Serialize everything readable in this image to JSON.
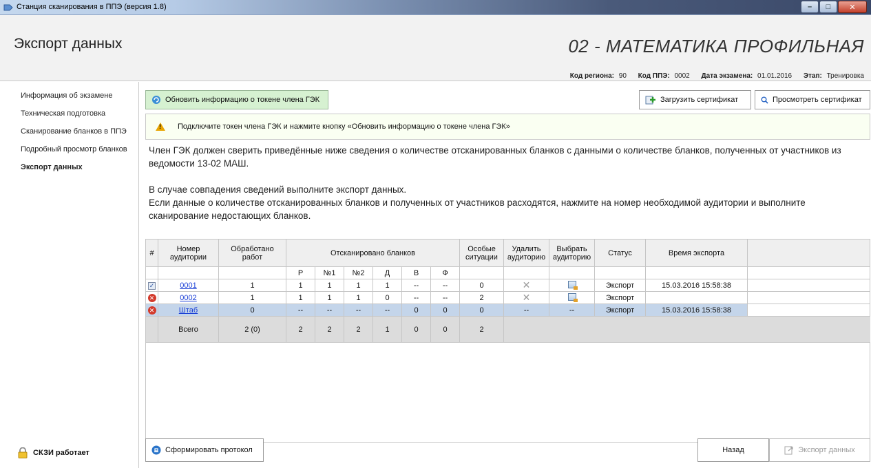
{
  "window": {
    "title": "Станция сканирования в ППЭ (версия 1.8)"
  },
  "header": {
    "title": "Экспорт данных",
    "subject": "02 - МАТЕМАТИКА ПРОФИЛЬНАЯ",
    "region_label": "Код региона:",
    "region_value": "90",
    "ppe_label": "Код ППЭ:",
    "ppe_value": "0002",
    "date_label": "Дата экзамена:",
    "date_value": "01.01.2016",
    "stage_label": "Этап:",
    "stage_value": "Тренировка"
  },
  "sidebar": {
    "items": [
      {
        "label": "Информация об экзамене"
      },
      {
        "label": "Техническая подготовка"
      },
      {
        "label": "Сканирование бланков в ППЭ"
      },
      {
        "label": "Подробный просмотр бланков"
      },
      {
        "label": "Экспорт данных"
      }
    ],
    "status": "СКЗИ работает"
  },
  "toolbar": {
    "refresh": "Обновить информацию о токене члена ГЭК",
    "upload": "Загрузить сертификат",
    "view": "Просмотреть сертификат"
  },
  "warning": "Подключите токен члена ГЭК и нажмите кнопку «Обновить информацию о токене члена ГЭК»",
  "description": {
    "p1": "Член ГЭК должен сверить приведённые ниже сведения о количестве отсканированных бланков с данными о количестве бланков, полученных от участников из ведомости 13-02 МАШ.",
    "p2a": "В случае совпадения сведений выполните экспорт данных.",
    "p2b": "Если данные о количестве отсканированных бланков и полученных от участников расходятся, нажмите на номер необходимой аудитории и выполните сканирование недостающих бланков."
  },
  "table": {
    "headers": {
      "num": "#",
      "room": "Номер аудитории",
      "processed": "Обработано работ",
      "scanned": "Отсканировано бланков",
      "special": "Особые ситуации",
      "delete": "Удалить аудиторию",
      "select": "Выбрать аудиторию",
      "status": "Статус",
      "time": "Время экспорта"
    },
    "subheaders": [
      "Р",
      "№1",
      "№2",
      "Д",
      "В",
      "Ф"
    ],
    "rows": [
      {
        "room": "0001",
        "processed": "1",
        "r": "1",
        "n1": "1",
        "n2": "1",
        "d": "1",
        "v": "--",
        "f": "--",
        "special": "0",
        "status": "Экспорт",
        "time": "15.03.2016 15:58:38"
      },
      {
        "room": "0002",
        "processed": "1",
        "r": "1",
        "n1": "1",
        "n2": "1",
        "d": "0",
        "v": "--",
        "f": "--",
        "special": "2",
        "status": "Экспорт",
        "time": ""
      },
      {
        "room": "Штаб",
        "processed": "0",
        "r": "--",
        "n1": "--",
        "n2": "--",
        "d": "--",
        "v": "0",
        "f": "0",
        "special": "0",
        "delete": "--",
        "select": "--",
        "status": "Экспорт",
        "time": "15.03.2016 15:58:38"
      }
    ],
    "total": {
      "label": "Всего",
      "processed": "2 (0)",
      "r": "2",
      "n1": "2",
      "n2": "2",
      "d": "1",
      "v": "0",
      "f": "0",
      "special": "2"
    }
  },
  "footer": {
    "protocol": "Сформировать протокол",
    "back": "Назад",
    "export": "Экспорт данных"
  }
}
